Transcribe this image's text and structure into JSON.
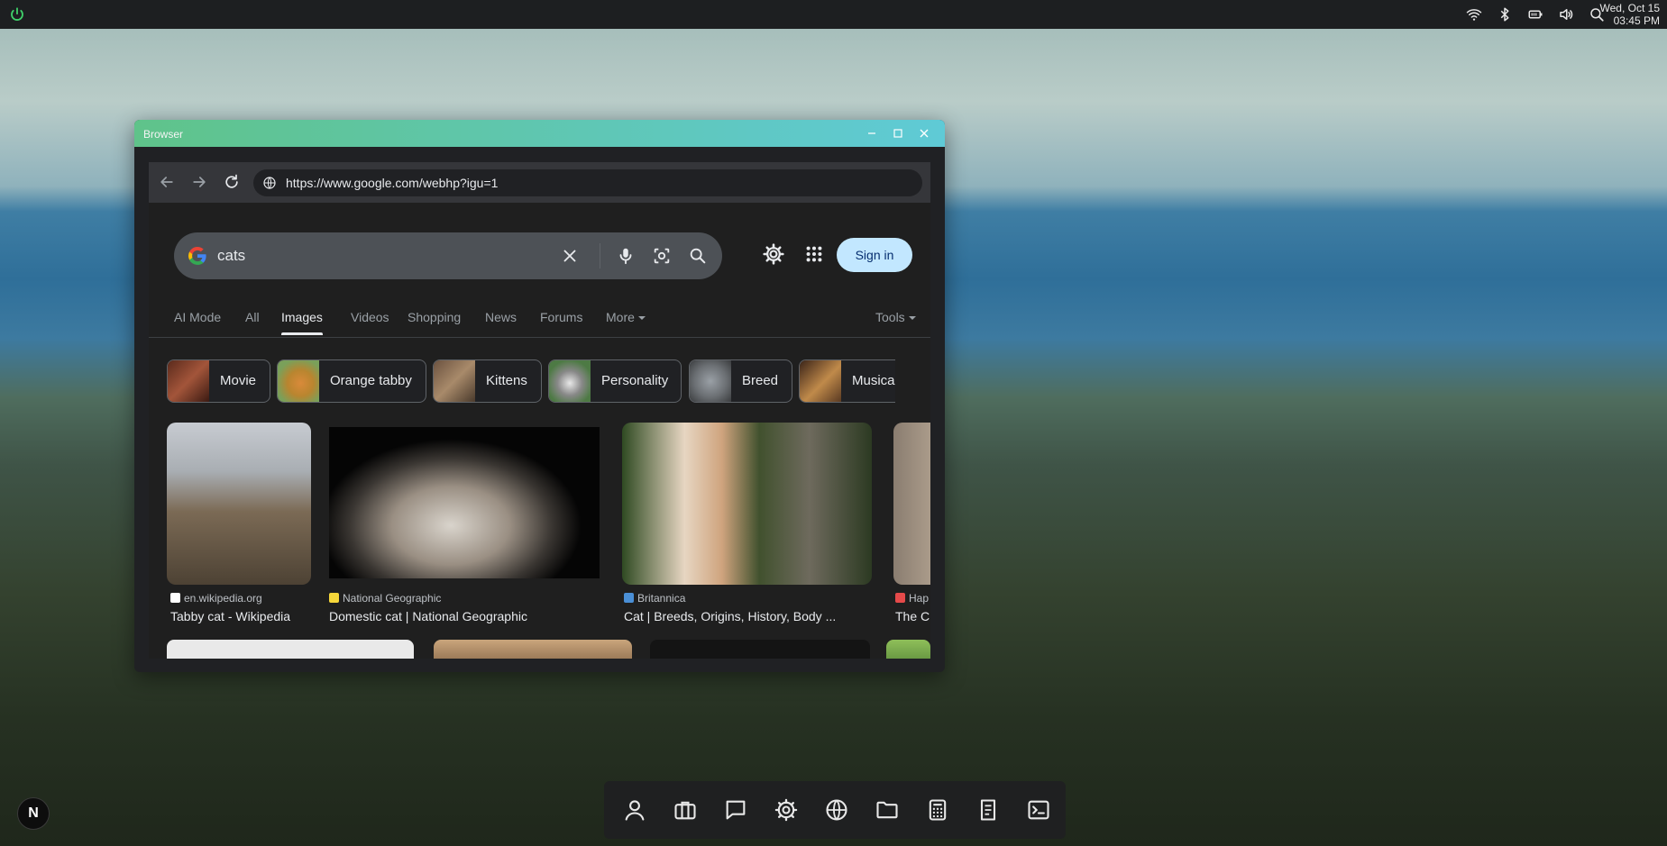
{
  "topbar": {
    "icons": [
      "power-icon",
      "wifi-icon",
      "bluetooth-icon",
      "battery-icon",
      "volume-icon",
      "search-icon"
    ],
    "date": "Wed, Oct 15",
    "time": "03:45 PM"
  },
  "window": {
    "title": "Browser",
    "controls": [
      "minimize",
      "maximize",
      "close"
    ]
  },
  "browser": {
    "url": "https://www.google.com/webhp?igu=1"
  },
  "google": {
    "query": "cats",
    "sign_in": "Sign in",
    "tabs": [
      "AI Mode",
      "All",
      "Images",
      "Videos",
      "Shopping",
      "News",
      "Forums",
      "More"
    ],
    "active_tab": "Images",
    "tools": "Tools",
    "chips": [
      "Movie",
      "Orange tabby",
      "Kittens",
      "Personality",
      "Breed",
      "Musica"
    ],
    "results": [
      {
        "source": "en.wikipedia.org",
        "title": "Tabby cat - Wikipedia"
      },
      {
        "source": "National Geographic",
        "title": "Domestic cat | National Geographic"
      },
      {
        "source": "Britannica",
        "title": "Cat | Breeds, Origins, History, Body ..."
      },
      {
        "source": "Hap",
        "title": "The C"
      }
    ]
  },
  "dock": {
    "items": [
      "user-icon",
      "briefcase-icon",
      "chat-icon",
      "settings-icon",
      "globe-icon",
      "folder-icon",
      "calculator-icon",
      "document-icon",
      "terminal-icon"
    ]
  },
  "badge": "N",
  "colors": {
    "accent_green": "#5fc38a",
    "accent_teal": "#5fcad6",
    "signin_bg": "#c2e7ff"
  }
}
